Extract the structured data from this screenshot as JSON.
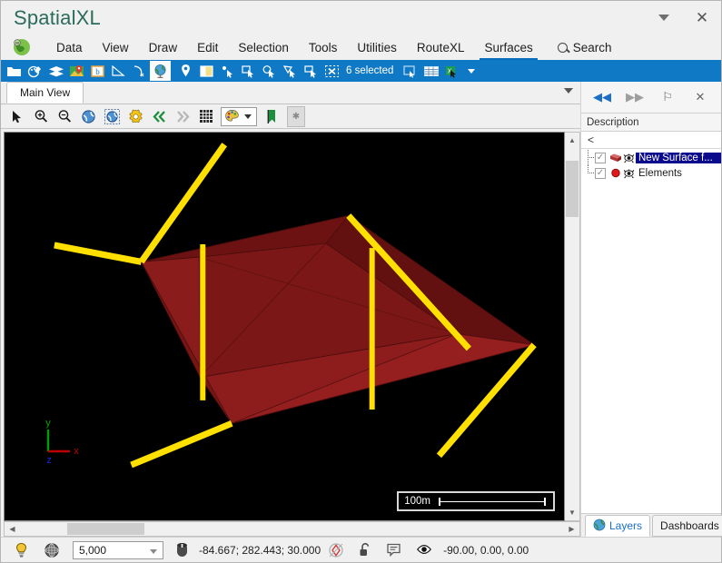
{
  "window": {
    "title": "SpatialXL",
    "controls": [
      {
        "name": "more-icon",
        "glyph": "caret"
      },
      {
        "name": "close-icon",
        "glyph": "✕"
      }
    ]
  },
  "menubar": {
    "app_icon": "app-globe-icon",
    "items": [
      {
        "label": "Data",
        "active": false
      },
      {
        "label": "View",
        "active": false
      },
      {
        "label": "Draw",
        "active": false
      },
      {
        "label": "Edit",
        "active": false
      },
      {
        "label": "Selection",
        "active": false
      },
      {
        "label": "Tools",
        "active": false
      },
      {
        "label": "Utilities",
        "active": false
      },
      {
        "label": "RouteXL",
        "active": false
      },
      {
        "label": "Surfaces",
        "active": true
      }
    ],
    "search_label": "Search"
  },
  "ribbon": {
    "selection_status": "6 selected",
    "icons": [
      "open-folder-icon",
      "palette-edit-icon",
      "layers-icon",
      "map-pin-image-icon",
      "boundary-icon",
      "triangle-measure-icon",
      "curve-tool-icon",
      "globe-icon",
      "location-pin-icon",
      "snapshot-icon",
      "select-point-icon",
      "select-rectangle-icon",
      "select-circle-icon",
      "select-polygon-icon",
      "select-crop-icon",
      "clear-selection-icon",
      "report-icon",
      "table-icon",
      "excel-export-icon"
    ]
  },
  "document": {
    "tabs": [
      {
        "label": "Main View",
        "active": true
      }
    ],
    "view_toolbar": [
      "pointer-icon",
      "zoom-in-icon",
      "zoom-out-icon",
      "globe-zoom-extents-icon",
      "globe-zoom-selected-icon",
      "settings-gear-icon",
      "previous-view-icon",
      "next-view-icon",
      "grid-icon",
      "color-palette-icon",
      "bookmark-icon",
      "star-icon"
    ]
  },
  "viewport": {
    "background_color": "#000000",
    "scalebar_label": "100m",
    "axis": {
      "x_label": "x",
      "y_label": "y",
      "z_label": "z",
      "x_color": "#c00000",
      "y_color": "#00a000",
      "z_color": "#0000cc"
    },
    "surface": {
      "fill_light": "#8f1b1b",
      "fill_mid": "#7d1717",
      "fill_dark": "#6b1212",
      "edge_color": "#4a0d0d",
      "line_color": "#ffe000"
    }
  },
  "right_panel": {
    "header_buttons": [
      {
        "name": "collapse-left-icon",
        "glyph": "◀◀",
        "state": "enabled"
      },
      {
        "name": "expand-right-icon",
        "glyph": "▶▶",
        "state": "disabled"
      },
      {
        "name": "pin-icon",
        "glyph": "⚐",
        "state": "enabled"
      },
      {
        "name": "close-panel-icon",
        "glyph": "✕",
        "state": "enabled"
      }
    ],
    "column_header": "Description",
    "filter_value": "<",
    "tree": [
      {
        "label": "New Surface f...",
        "checked": true,
        "selected": true,
        "icon": "surface-solid-icon",
        "visibility": "eye-icon"
      },
      {
        "label": "Elements",
        "checked": true,
        "selected": false,
        "icon": "red-dot-icon",
        "visibility": "eye-icon"
      }
    ],
    "tabs": [
      {
        "label": "Layers",
        "active": true,
        "icon": "globe-icon"
      },
      {
        "label": "Dashboards",
        "active": false,
        "icon": ""
      }
    ]
  },
  "statusbar": {
    "light_icon": "lightbulb-icon",
    "globe_icon": "globe-icon",
    "scale_value": "5,000",
    "mouse_icon": "mouse-icon",
    "coordinates": "-84.667; 282.443; 30.000",
    "snap_icon": "snap-target-icon",
    "lock_icon": "unlock-icon",
    "note_icon": "note-icon",
    "eye_icon": "eye-icon",
    "orientation": "-90.00, 0.00, 0.00"
  }
}
